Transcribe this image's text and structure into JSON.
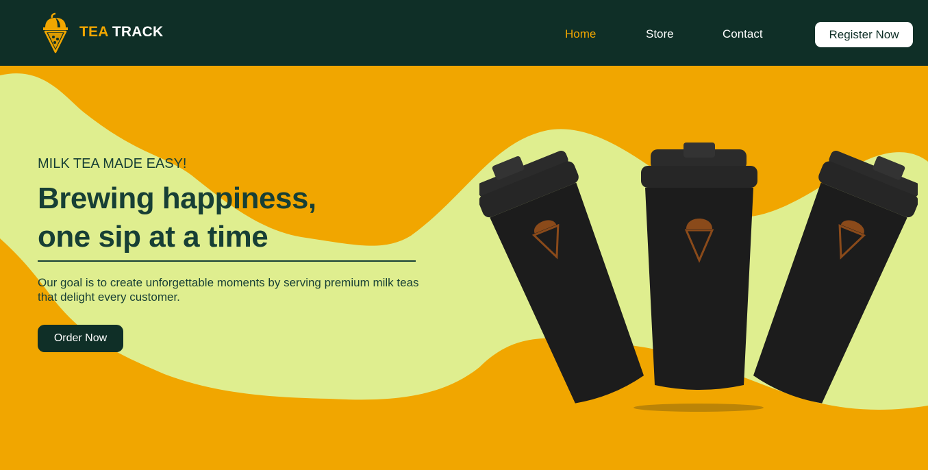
{
  "brand": {
    "name_part1": "TEA",
    "name_part2": "TRACK",
    "logo_icon": "milk-tea-cone-icon"
  },
  "nav": {
    "items": [
      {
        "label": "Home",
        "active": true
      },
      {
        "label": "Store",
        "active": false
      },
      {
        "label": "Contact",
        "active": false
      }
    ],
    "cta_label": "Register Now"
  },
  "hero": {
    "eyebrow": "MILK TEA MADE EASY!",
    "headline_line1": "Brewing happiness,",
    "headline_line2": "one sip at a time",
    "description": "Our goal is to create unforgettable moments by serving premium milk teas that delight every customer.",
    "cta_label": "Order Now"
  },
  "colors": {
    "nav_bg": "#0f2f27",
    "accent": "#f1a600",
    "wave": "#dfee8f",
    "text_dark": "#173f35",
    "tumbler": "#1e1e1e",
    "tumbler_logo": "#8a4a1a"
  }
}
